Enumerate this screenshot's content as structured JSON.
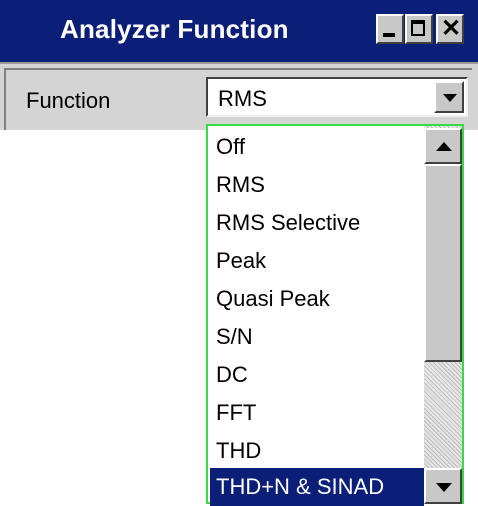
{
  "window": {
    "title": "Analyzer Function",
    "minimize_icon": "minimize-icon",
    "maximize_icon": "maximize-icon",
    "close_symbol": "✕"
  },
  "field": {
    "label": "Function",
    "selected_value": "RMS"
  },
  "dropdown": {
    "options": [
      "Off",
      "RMS",
      "RMS Selective",
      "Peak",
      "Quasi Peak",
      "S/N",
      "DC",
      "FFT",
      "THD",
      "THD+N & SINAD"
    ],
    "highlighted": "THD+N & SINAD"
  },
  "colors": {
    "titlebar": "#0b1f78",
    "dropdown_border": "#33dd44",
    "highlight": "#0b1f78"
  }
}
